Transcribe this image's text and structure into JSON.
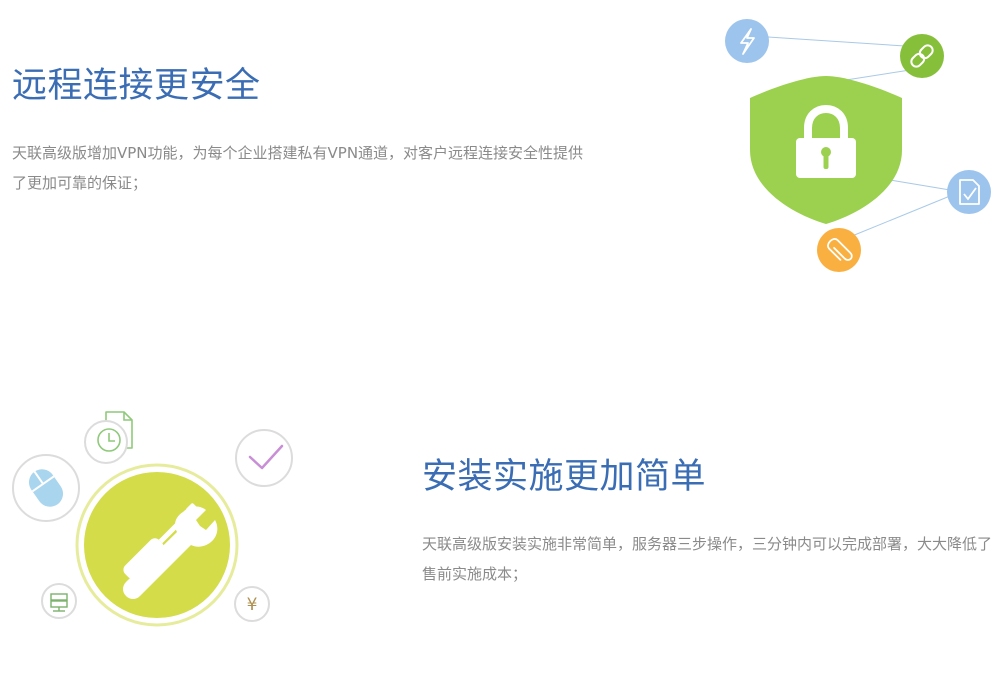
{
  "sections": [
    {
      "title": "远程连接更安全",
      "description": "天联高级版增加VPN功能，为每个企业搭建私有VPN通道，对客户远程连接安全性提供了更加可靠的保证；",
      "illustration": {
        "main": "shield-lock-icon",
        "satellites": [
          "lightning-icon",
          "link-icon",
          "document-check-icon",
          "paperclip-icon"
        ],
        "colors": {
          "shield": "#9bd14f",
          "lightning": "#9cc4ec",
          "link": "#86c03b",
          "document": "#9cc4ec",
          "paperclip": "#f9b040",
          "lines": "#a9c9e8"
        }
      }
    },
    {
      "title": "安装实施更加简单",
      "description": "天联高级版安装实施非常简单，服务器三步操作，三分钟内可以完成部署，大大降低了售前实施成本；",
      "illustration": {
        "main": "wrench-screwdriver-icon",
        "satellites": [
          "clock-document-icon",
          "mouse-icon",
          "checkmark-icon",
          "server-icon",
          "yen-icon"
        ],
        "yen_symbol": "¥",
        "colors": {
          "main": "#d4dc4a",
          "ring": "#e6ec9c",
          "mouse": "#a9d6ee",
          "check": "#c98fd6",
          "clock": "#8fc97a",
          "server": "#7db26c",
          "yen": "#b09050"
        }
      }
    }
  ]
}
